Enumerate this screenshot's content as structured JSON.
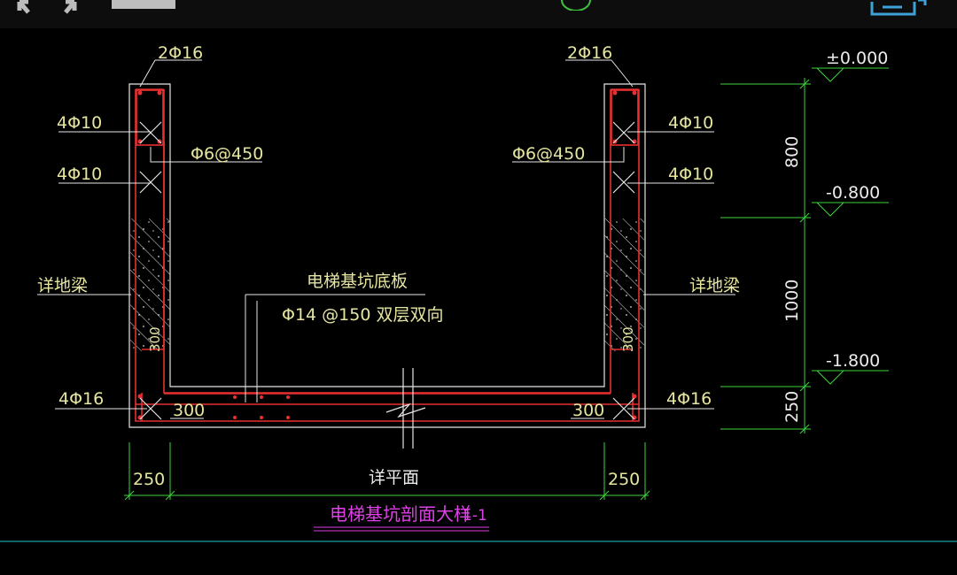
{
  "toolbar": {
    "icons": [
      "expand-arrows-icon",
      "panel-icon",
      "circle-indicator-icon",
      "layers-icon"
    ]
  },
  "drawing": {
    "title": "电梯基坑剖面大样",
    "section_id": "1-1",
    "left_labels": {
      "top_bar": "2Φ16",
      "upper_stirrup_bars": "4Φ10",
      "lower_stirrup_bars": "4Φ10",
      "tie": "Φ6@450",
      "ground_beam": "详地梁",
      "corner_bars": "4Φ16",
      "inner_dim": "300",
      "width_dim": "250"
    },
    "right_labels": {
      "top_bar": "2Φ16",
      "upper_stirrup_bars": "4Φ10",
      "lower_stirrup_bars": "4Φ10",
      "tie": "Φ6@450",
      "ground_beam": "详地梁",
      "corner_bars": "4Φ16",
      "inner_dim": "300",
      "width_dim": "250"
    },
    "slab": {
      "name": "电梯基坑底板",
      "rebar": "Φ14 @150 双层双向",
      "plan_ref": "详平面"
    },
    "wall_thickness_mark": "300",
    "elevations": [
      "±0.000",
      "-0.800",
      "-1.800"
    ],
    "vertical_dims": [
      "800",
      "1000",
      "250"
    ]
  }
}
